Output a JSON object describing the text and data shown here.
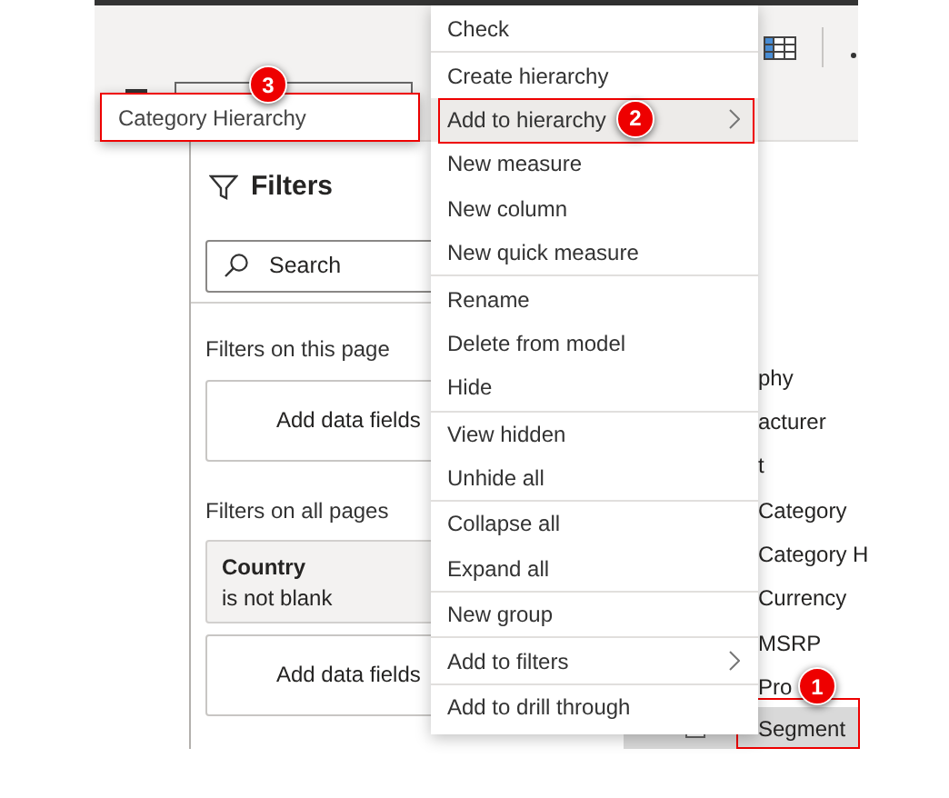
{
  "tooltip": {
    "text": "Category Hierarchy",
    "badge": "3"
  },
  "filters": {
    "title": "Filters",
    "search": {
      "placeholder": "Search"
    },
    "sections": [
      {
        "heading": "Filters on this page",
        "cards": [
          {
            "kind": "add",
            "text": "Add data fields"
          }
        ]
      },
      {
        "heading": "Filters on all pages",
        "cards": [
          {
            "kind": "filter",
            "field": "Country",
            "condition": "is not blank"
          },
          {
            "kind": "add",
            "text": "Add data fields"
          }
        ]
      }
    ]
  },
  "context_menu": {
    "groups": [
      [
        {
          "label": "Check",
          "selected": false,
          "submenu": false
        }
      ],
      [
        {
          "label": "Create hierarchy",
          "selected": false,
          "submenu": false
        },
        {
          "label": "Add to hierarchy",
          "selected": true,
          "submenu": true,
          "badge": "2"
        },
        {
          "label": "New measure",
          "selected": false,
          "submenu": false
        },
        {
          "label": "New column",
          "selected": false,
          "submenu": false
        },
        {
          "label": "New quick measure",
          "selected": false,
          "submenu": false
        }
      ],
      [
        {
          "label": "Rename",
          "selected": false,
          "submenu": false
        },
        {
          "label": "Delete from model",
          "selected": false,
          "submenu": false
        },
        {
          "label": "Hide",
          "selected": false,
          "submenu": false
        }
      ],
      [
        {
          "label": "View hidden",
          "selected": false,
          "submenu": false
        },
        {
          "label": "Unhide all",
          "selected": false,
          "submenu": false
        }
      ],
      [
        {
          "label": "Collapse all",
          "selected": false,
          "submenu": false
        },
        {
          "label": "Expand all",
          "selected": false,
          "submenu": false
        }
      ],
      [
        {
          "label": "New group",
          "selected": false,
          "submenu": false
        }
      ],
      [
        {
          "label": "Add to filters",
          "selected": false,
          "submenu": true
        }
      ],
      [
        {
          "label": "Add to drill through",
          "selected": false,
          "submenu": false
        }
      ]
    ]
  },
  "fields": {
    "items": [
      {
        "label": "phy",
        "selected": false
      },
      {
        "label": "acturer",
        "selected": false
      },
      {
        "label": "t",
        "selected": false
      },
      {
        "label": "Category",
        "selected": false
      },
      {
        "label": "Category H",
        "selected": false
      },
      {
        "label": "Currency",
        "selected": false
      },
      {
        "label": "MSRP",
        "selected": false
      },
      {
        "label": "Pro",
        "selected": false
      },
      {
        "label": "Segment",
        "selected": true,
        "checked": false,
        "badge": "1"
      }
    ]
  }
}
